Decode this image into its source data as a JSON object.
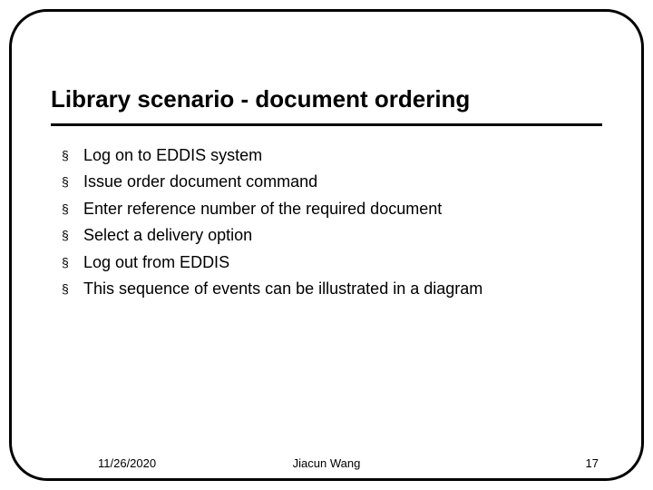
{
  "title": "Library scenario - document ordering",
  "bullets": [
    "Log on to EDDIS system",
    "Issue order document command",
    "Enter reference number of the required document",
    "Select a delivery option",
    "Log out from EDDIS",
    "This sequence of events can be illustrated in a diagram"
  ],
  "footer": {
    "date": "11/26/2020",
    "author": "Jiacun Wang",
    "page": "17"
  }
}
